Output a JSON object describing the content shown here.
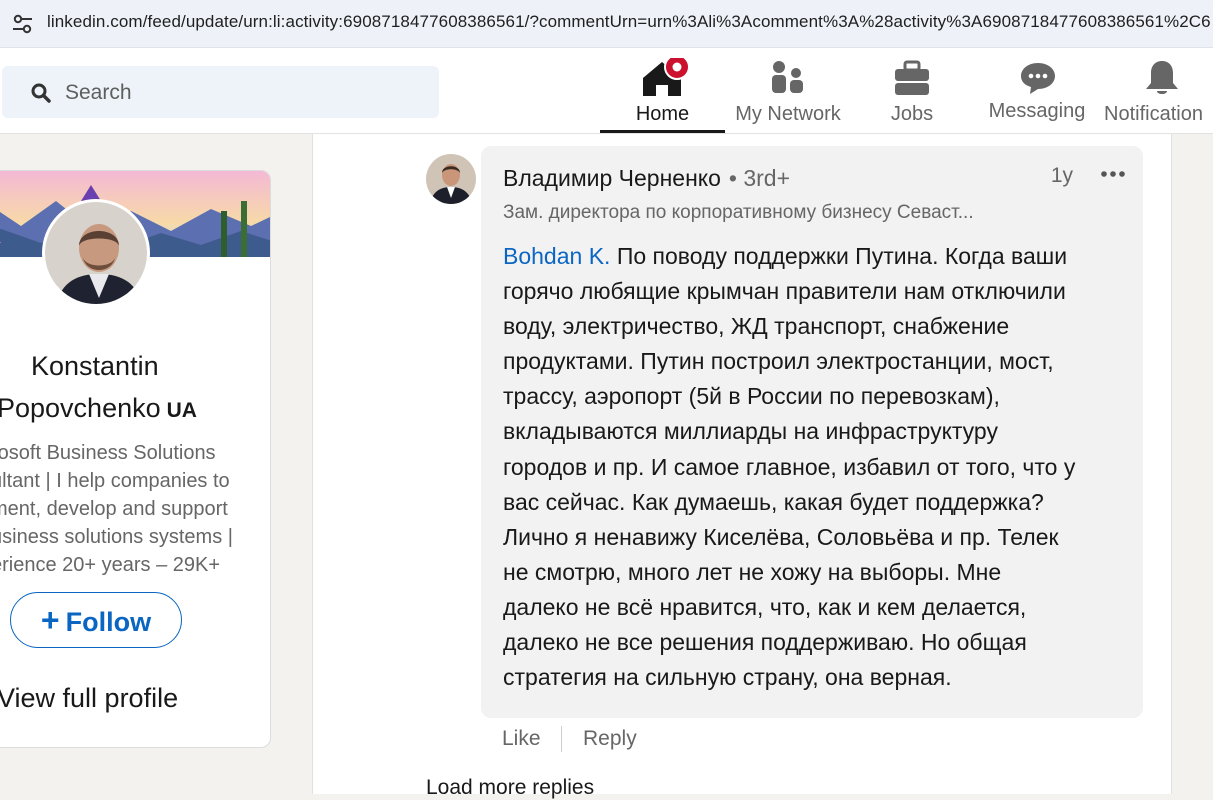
{
  "browser": {
    "url": "linkedin.com/feed/update/urn:li:activity:6908718477608386561/?commentUrn=urn%3Ali%3Acomment%3A%28activity%3A6908718477608386561%2C6"
  },
  "nav": {
    "search_placeholder": "Search",
    "items": [
      {
        "label": "Home",
        "icon": "home-icon"
      },
      {
        "label": "My Network",
        "icon": "my-network-icon"
      },
      {
        "label": "Jobs",
        "icon": "jobs-icon"
      },
      {
        "label": "Messaging",
        "icon": "messaging-icon"
      },
      {
        "label": "Notification",
        "icon": "bell-icon"
      }
    ],
    "active": "Home",
    "accent": "#191919",
    "badge_color": "#cb112d"
  },
  "profile_card": {
    "name_line1": "Konstantin",
    "name_line2": "Popovchenko",
    "flag": "UA",
    "headline_lines": [
      "rosoft Business Solutions",
      "ultant | I help companies to",
      "ment, develop and support",
      "usiness solutions systems |",
      "erience 20+ years – 29K+"
    ],
    "follow_label": "Follow",
    "view_profile_label": "View full profile"
  },
  "comment": {
    "author": "Владимир Черненко",
    "degree": "• 3rd+",
    "time": "1y",
    "author_title": "Зам. директора по корпоративному бизнесу Севаст...",
    "mention": "Bohdan K.",
    "lines": [
      "По поводу поддержки Путина. Когда ваши",
      "горячо любящие крымчан правители нам отключили",
      "воду, электричество, ЖД транспорт, снабжение",
      "продуктами. Путин построил электростанции, мост,",
      "трассу, аэропорт (5й в России по перевозкам),",
      "вкладываются миллиарды на инфраструктуру",
      "городов и пр. И самое главное, избавил от того, что у",
      "вас сейчас. Как думаешь, какая будет поддержка?",
      "Лично я ненавижу Киселёва, Соловьёва и пр. Телек",
      "не смотрю, много лет не хожу на выборы. Мне",
      "далеко не всё нравится, что, как и кем делается,",
      "далеко не все решения поддерживаю. Но общая",
      "стратегия на сильную страну, она верная."
    ],
    "like_label": "Like",
    "reply_label": "Reply"
  },
  "load_more_label": "Load more replies"
}
